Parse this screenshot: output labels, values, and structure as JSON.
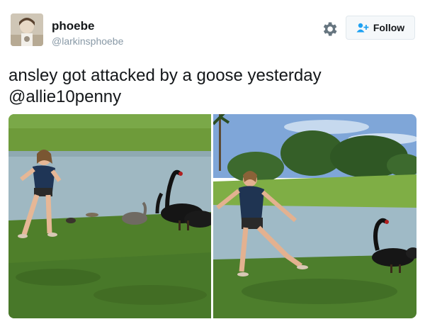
{
  "user": {
    "display_name": "phoebe",
    "handle": "@larkinsphoebe",
    "avatar_icon": "avatar-photo"
  },
  "actions": {
    "settings_icon": "gear-icon",
    "follow_icon": "add-user-icon",
    "follow_label": "Follow"
  },
  "tweet": {
    "line1": "ansley got attacked by a goose yesterday",
    "line2": "@allie10penny"
  },
  "media": {
    "photos": [
      {
        "description_icon": "photo-girl-black-swans-pond-left"
      },
      {
        "description_icon": "photo-girl-running-from-black-swan-right"
      }
    ]
  },
  "colors": {
    "text": "#14171a",
    "secondary_text": "#8899a6",
    "follow_icon": "#1da1f2",
    "button_border": "#e1e8ed",
    "button_bg": "#f5f8fa"
  }
}
